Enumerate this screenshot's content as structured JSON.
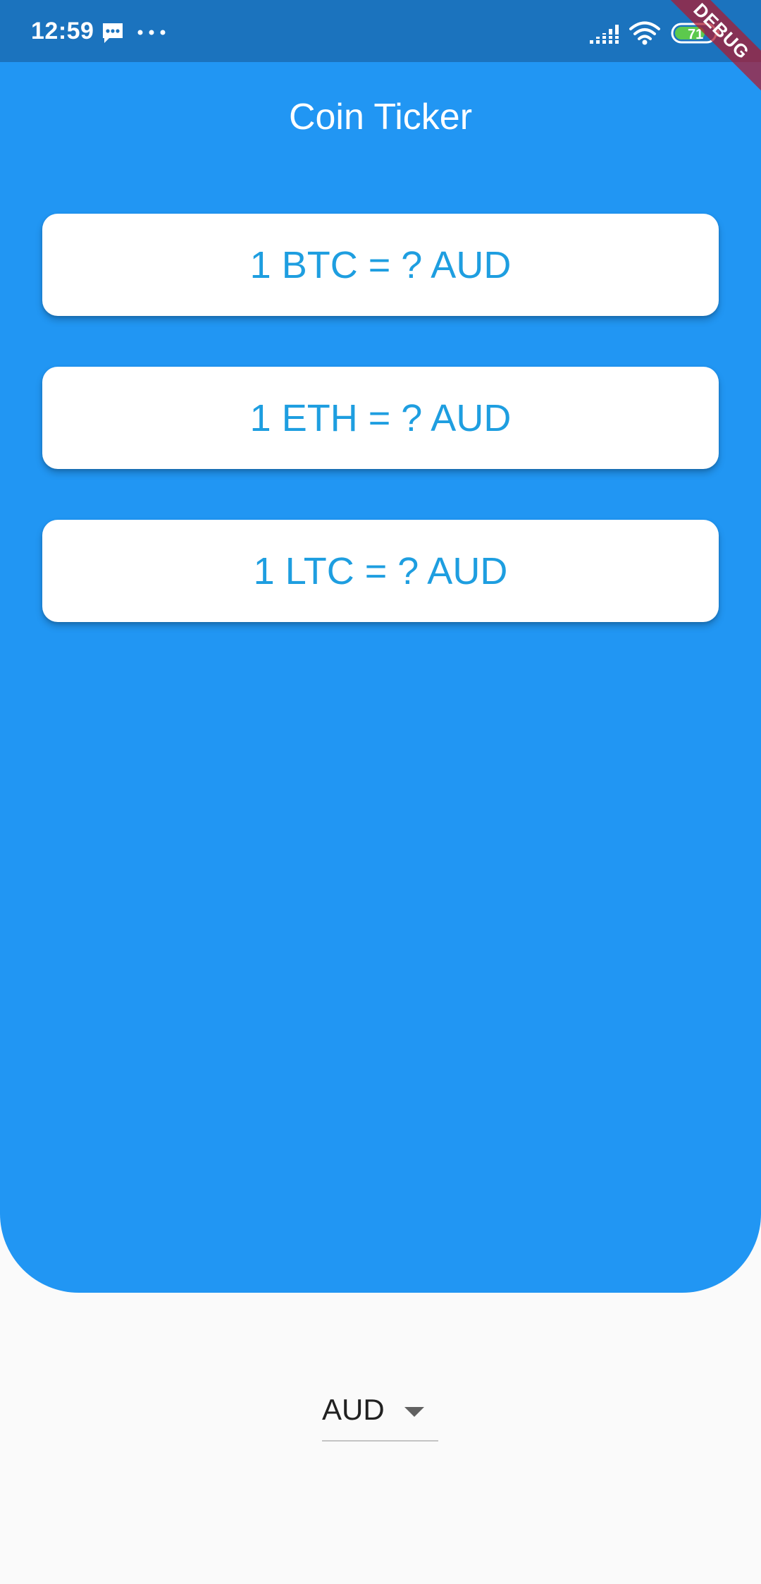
{
  "status_bar": {
    "time": "12:59",
    "battery_level": "71",
    "icons": [
      "message-icon",
      "more-dots-icon",
      "signal-icon",
      "wifi-icon",
      "battery-icon"
    ]
  },
  "debug_banner": "DEBUG",
  "header": {
    "title": "Coin Ticker"
  },
  "rates": [
    {
      "label": "1 BTC = ? AUD"
    },
    {
      "label": "1 ETH = ? AUD"
    },
    {
      "label": "1 LTC = ? AUD"
    }
  ],
  "currency_picker": {
    "selected": "AUD",
    "icon": "dropdown-arrow-icon"
  },
  "colors": {
    "status_bar": "#1b73be",
    "primary": "#2196f3",
    "rate_text": "#1e9ee0",
    "card": "#ffffff",
    "background": "#fafafa",
    "debug_ribbon": "#b0182c"
  }
}
